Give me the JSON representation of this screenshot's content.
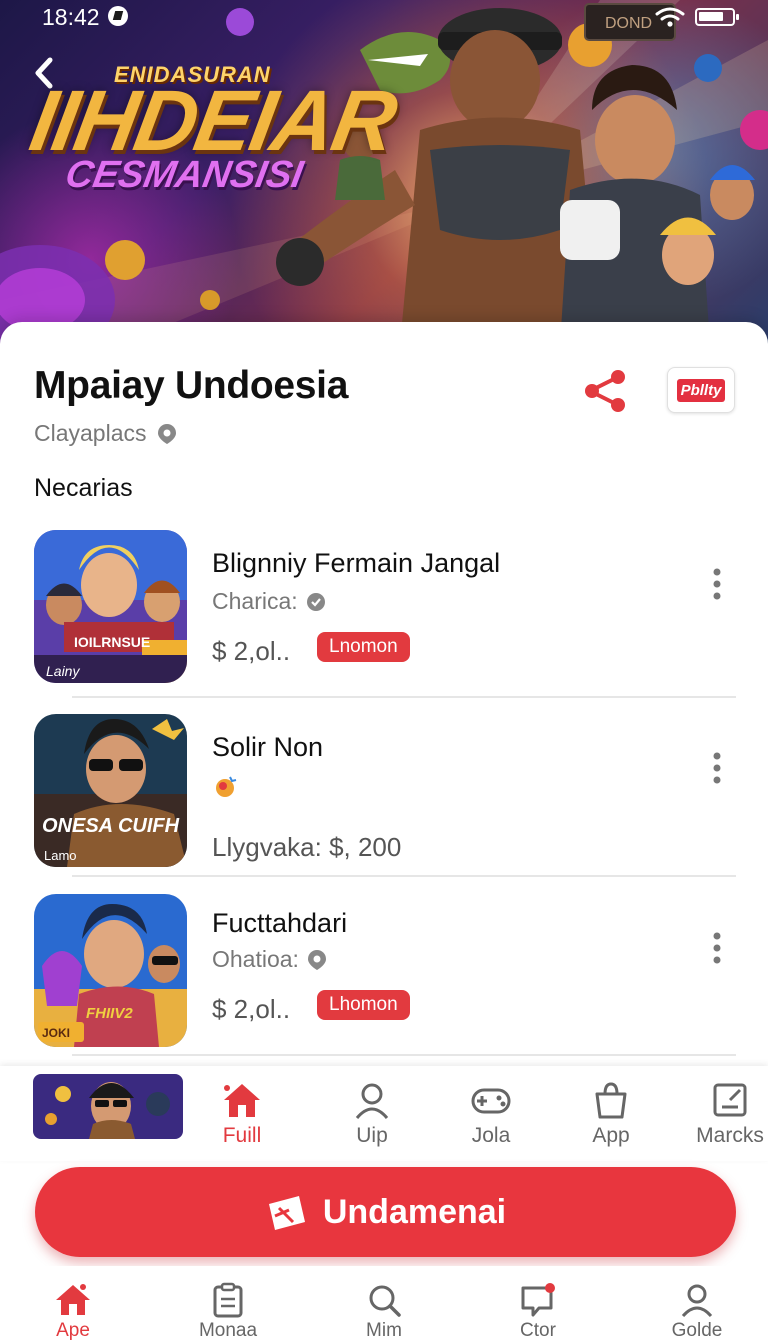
{
  "status_bar": {
    "time": "18:42"
  },
  "hero": {
    "logo_line1": "ENIDASURAN",
    "logo_line2": "IIHDEIAR",
    "logo_line3": "CESMANSISI"
  },
  "header": {
    "title": "Mpaiay Undoesia",
    "subtitle": "Clayaplacs",
    "badge": "Pbllty"
  },
  "section": {
    "title": "Necarias"
  },
  "items": [
    {
      "title": "Blignniy Fermain Jangal",
      "subtitle": "Charica:",
      "price": "$ 2,ol..",
      "tag": "Lnomon",
      "thumb_label": "Lainy",
      "thumb_banner": "IOILRNSUE"
    },
    {
      "title": "Solir Non",
      "subtitle": "",
      "price": "Llygvaka:  $, 200",
      "tag": "",
      "thumb_label": "Lamo",
      "thumb_banner": "ONESA CUIFH"
    },
    {
      "title": "Fucttahdari",
      "subtitle": "Ohatioa:",
      "price": "$ 2,ol..",
      "tag": "Lhomon",
      "thumb_label": "JOKI",
      "thumb_banner": "FHIIV2"
    }
  ],
  "mid_nav": [
    {
      "label": "Fuill",
      "icon": "home-icon",
      "active": true
    },
    {
      "label": "Uip",
      "icon": "user-icon",
      "active": false
    },
    {
      "label": "Jola",
      "icon": "gamepad-icon",
      "active": false
    },
    {
      "label": "App",
      "icon": "bag-icon",
      "active": false
    },
    {
      "label": "Marcks",
      "icon": "edit-icon",
      "active": false
    }
  ],
  "cta": {
    "label": "Undamenai"
  },
  "bottom_nav": [
    {
      "label": "Ape",
      "icon": "home-icon",
      "active": true
    },
    {
      "label": "Monaa",
      "icon": "clipboard-icon",
      "active": false
    },
    {
      "label": "Mim",
      "icon": "search-icon",
      "active": false
    },
    {
      "label": "Ctor",
      "icon": "chat-icon",
      "active": false
    },
    {
      "label": "Golde",
      "icon": "profile-icon",
      "active": false
    }
  ],
  "colors": {
    "accent": "#e8363e",
    "text": "#111111",
    "muted": "#777777"
  }
}
